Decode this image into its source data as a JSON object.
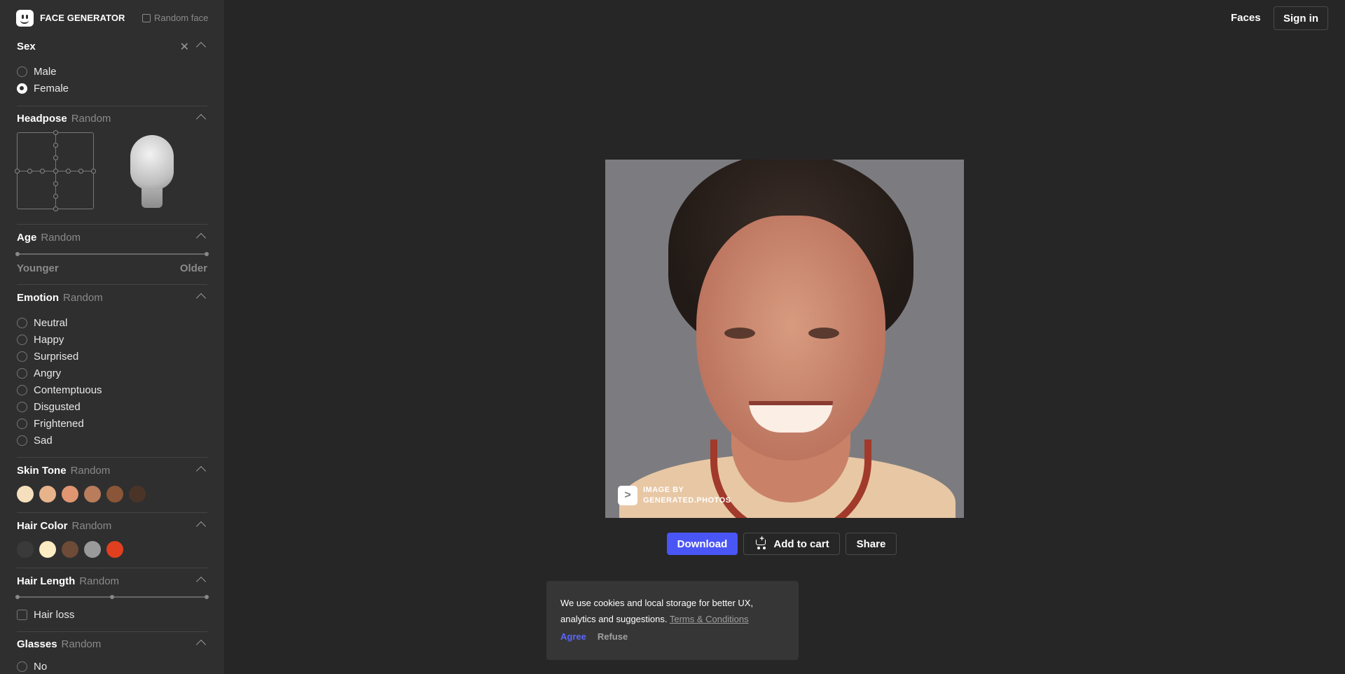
{
  "brand": {
    "name": "FACE GENERATOR",
    "random_face": "Random face"
  },
  "header": {
    "faces": "Faces",
    "sign_in": "Sign in"
  },
  "sidebar": {
    "sex": {
      "title": "Sex",
      "options": [
        "Male",
        "Female"
      ],
      "selected": "Female"
    },
    "headpose": {
      "title": "Headpose",
      "value": "Random"
    },
    "age": {
      "title": "Age",
      "value": "Random",
      "min_label": "Younger",
      "max_label": "Older"
    },
    "emotion": {
      "title": "Emotion",
      "value": "Random",
      "options": [
        "Neutral",
        "Happy",
        "Surprised",
        "Angry",
        "Contemptuous",
        "Disgusted",
        "Frightened",
        "Sad"
      ]
    },
    "skin_tone": {
      "title": "Skin Tone",
      "value": "Random",
      "colors": [
        "#f6dfbd",
        "#e7b38b",
        "#df9671",
        "#b97d5b",
        "#8a5637",
        "#4a3428"
      ]
    },
    "hair_color": {
      "title": "Hair Color",
      "value": "Random",
      "colors": [
        "#3a3a3a",
        "#fbecc4",
        "#6e4b36",
        "#9a9a9a",
        "#e0401f"
      ]
    },
    "hair_length": {
      "title": "Hair Length",
      "value": "Random",
      "hair_loss": "Hair loss"
    },
    "glasses": {
      "title": "Glasses",
      "value": "Random",
      "first_option": "No"
    }
  },
  "photo": {
    "watermark_line1": "IMAGE BY",
    "watermark_line2": "GENERATED.PHOTOS"
  },
  "actions": {
    "download": "Download",
    "add_to_cart": "Add to cart",
    "share": "Share"
  },
  "cookie": {
    "line1": "We use cookies and local storage for better UX,",
    "line2": "analytics and suggestions.",
    "terms": "Terms & Conditions",
    "agree": "Agree",
    "refuse": "Refuse"
  }
}
